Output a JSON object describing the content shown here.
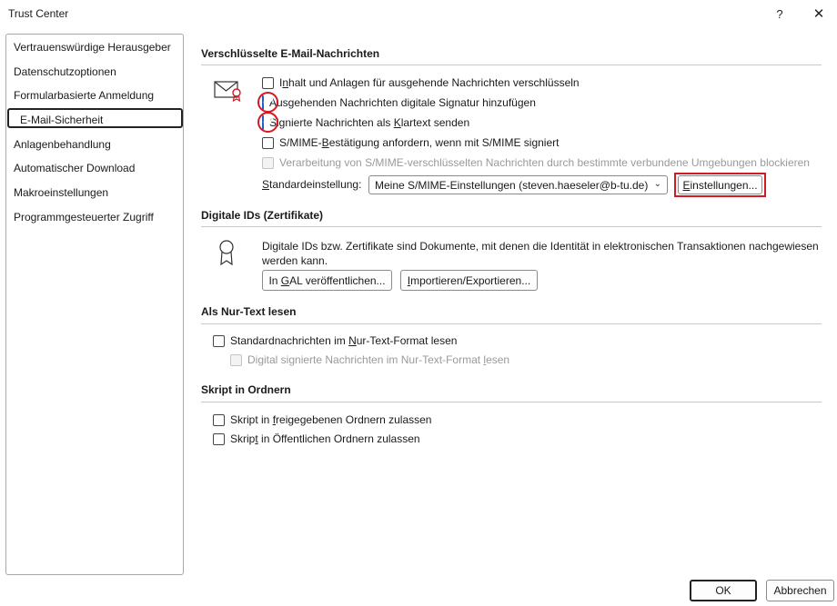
{
  "window": {
    "title": "Trust Center",
    "help_label": "?",
    "close_label": "✕"
  },
  "sidebar": {
    "items": [
      {
        "label": "Vertrauenswürdige Herausgeber"
      },
      {
        "label": "Datenschutzoptionen"
      },
      {
        "label": "Formularbasierte Anmeldung"
      },
      {
        "label": "E-Mail-Sicherheit",
        "active": true
      },
      {
        "label": "Anlagenbehandlung"
      },
      {
        "label": "Automatischer Download"
      },
      {
        "label": "Makroeinstellungen"
      },
      {
        "label": "Programmgesteuerter Zugriff"
      }
    ]
  },
  "encrypted": {
    "title": "Verschlüsselte E-Mail-Nachrichten",
    "opt_encrypt": {
      "pre": "I",
      "ul": "n",
      "post": "halt und Anlagen für ausgehende Nachrichten verschlüsseln",
      "checked": false
    },
    "opt_sign": {
      "label": "Ausgehenden Nachrichten digitale Signatur hinzufügen",
      "checked": true
    },
    "opt_cleartext": {
      "pre": "Signierte Nachrichten als ",
      "ul": "K",
      "post": "lartext senden",
      "checked": true
    },
    "opt_receipt": {
      "pre": "S/MIME-",
      "ul": "B",
      "post": "estätigung anfordern, wenn mit S/MIME signiert",
      "checked": false
    },
    "opt_block": {
      "label": "Verarbeitung von S/MIME-verschlüsselten Nachrichten durch bestimmte verbundene Umgebungen blockieren",
      "checked": false,
      "disabled": true
    },
    "default_label": {
      "ul": "S",
      "post": "tandardeinstellung:"
    },
    "default_value": "Meine S/MIME-Einstellungen (steven.haeseler@b-tu.de)",
    "settings_button": {
      "ul": "E",
      "post": "instellungen..."
    }
  },
  "digital_ids": {
    "title": "Digitale IDs (Zertifikate)",
    "description_line1": "Digitale IDs bzw. Zertifikate sind Dokumente, mit denen die Identität in elektronischen Transaktionen nachgewiesen",
    "description_line2": "werden kann.",
    "gal_button": {
      "pre": "In ",
      "ul": "G",
      "post": "AL veröffentlichen..."
    },
    "import_button": {
      "ul": "I",
      "post": "mportieren/Exportieren..."
    }
  },
  "plaintext": {
    "title": "Als Nur-Text lesen",
    "opt_read": {
      "pre": "Standardnachrichten im ",
      "ul": "N",
      "post": "ur-Text-Format lesen",
      "checked": false
    },
    "opt_signed": {
      "pre": "Digital signierte Nachrichten im Nur-Text-Format ",
      "ul": "l",
      "post": "esen",
      "checked": false,
      "disabled": true
    }
  },
  "scripts": {
    "title": "Skript in Ordnern",
    "opt_shared": {
      "pre": "Skript in ",
      "ul": "f",
      "post": "reigegebenen Ordnern zulassen",
      "checked": false
    },
    "opt_public": {
      "pre": "Skrip",
      "ul": "t",
      "post": " in Öffentlichen Ordnern zulassen",
      "checked": false
    }
  },
  "footer": {
    "ok_label": "OK",
    "cancel_label": "Abbrechen"
  },
  "colors": {
    "accent": "#1e64c8",
    "highlight": "#d21a24"
  },
  "icons": {
    "envelope": "envelope-certificate-icon",
    "certificate": "certificate-ribbon-icon"
  }
}
